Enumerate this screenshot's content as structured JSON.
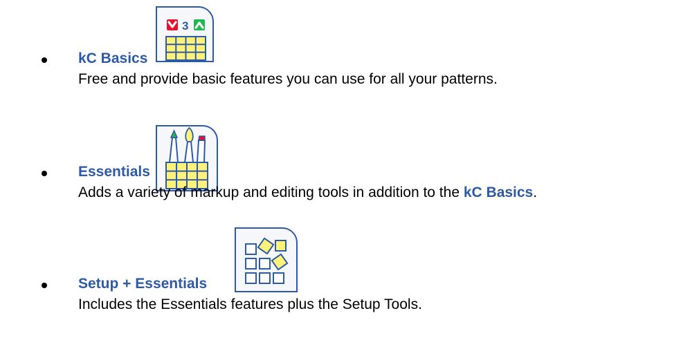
{
  "items": [
    {
      "title": "kC Basics",
      "description": "Free and provide basic features you can use for all your patterns.",
      "icon": "kc-basics-grid-icon",
      "counter": "3"
    },
    {
      "title": "Essentials",
      "description_prefix": "Adds a variety of markup and editing tools in addition to the ",
      "description_highlight": "kC Basics",
      "description_suffix": ".",
      "icon": "essentials-brushes-grid-icon"
    },
    {
      "title": "Setup + Essentials",
      "description": "Includes the Essentials features plus the Setup Tools.",
      "icon": "setup-squares-icon"
    }
  ],
  "colors": {
    "title_blue": "#2d5aa6",
    "grid_yellow": "#fff27a",
    "red": "#e8112d",
    "green": "#1fba4e"
  }
}
